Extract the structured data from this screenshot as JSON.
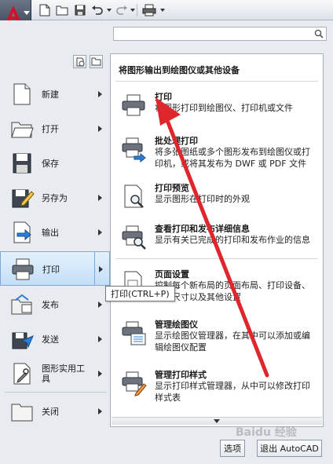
{
  "colors": {
    "accent_red": "#c8102e",
    "annotation_red": "#e0262d",
    "highlight": "#c4def6"
  },
  "quick_access": [
    {
      "name": "new-icon"
    },
    {
      "name": "open-icon"
    },
    {
      "name": "save-icon"
    },
    {
      "name": "undo-icon"
    },
    {
      "name": "redo-icon"
    },
    {
      "name": "plot-icon"
    }
  ],
  "left_menu": {
    "items": [
      {
        "label": "新建",
        "icon": "new-document-icon",
        "has_submenu": true
      },
      {
        "label": "打开",
        "icon": "open-folder-icon",
        "has_submenu": true
      },
      {
        "label": "保存",
        "icon": "floppy-disk-icon",
        "has_submenu": false
      },
      {
        "label": "另存为",
        "icon": "save-as-icon",
        "has_submenu": true
      },
      {
        "label": "输出",
        "icon": "export-icon",
        "has_submenu": true
      },
      {
        "label": "打印",
        "icon": "printer-icon",
        "has_submenu": true,
        "active": true
      },
      {
        "label": "发布",
        "icon": "publish-icon",
        "has_submenu": true
      },
      {
        "label": "发送",
        "icon": "send-icon",
        "has_submenu": true
      },
      {
        "label": "图形实用工具",
        "icon": "drawing-utilities-icon",
        "has_submenu": true
      },
      {
        "label": "关闭",
        "icon": "close-folder-icon",
        "has_submenu": true
      }
    ]
  },
  "submenu": {
    "header": "将图形输出到绘图仪或其他设备",
    "items": [
      {
        "title": "打印",
        "desc": "将图形打印到绘图仪、打印机或文件",
        "icon": "printer-icon"
      },
      {
        "title": "批处理打印",
        "desc": "将多张图纸或多个图形发布到绘图仪或打印机，或将其发布为 DWF 或 PDF 文件",
        "icon": "batch-plot-icon"
      },
      {
        "title": "打印预览",
        "desc": "显示图形在打印时的外观",
        "icon": "plot-preview-icon"
      },
      {
        "title": "查看打印和发布详细信息",
        "desc": "显示有关已完成的打印和发布作业的信息",
        "icon": "plot-details-icon"
      },
      {
        "title": "页面设置",
        "desc": "控制每个新布局的页面布局、打印设备、图纸尺寸以及其他设置",
        "icon": "page-setup-icon"
      },
      {
        "title": "管理绘图仪",
        "desc": "显示绘图仪管理器，在其中可以添加或编辑绘图仪配置",
        "icon": "plotter-manager-icon"
      },
      {
        "title": "管理打印样式",
        "desc": "显示打印样式管理器，从中可以修改打印样式表",
        "icon": "plot-style-manager-icon"
      }
    ]
  },
  "tooltip": "打印(CTRL+P)",
  "buttons": {
    "options": "选项",
    "exit": "退出 AutoCAD"
  },
  "search": {
    "placeholder": ""
  },
  "watermark": "Baidu 经验"
}
